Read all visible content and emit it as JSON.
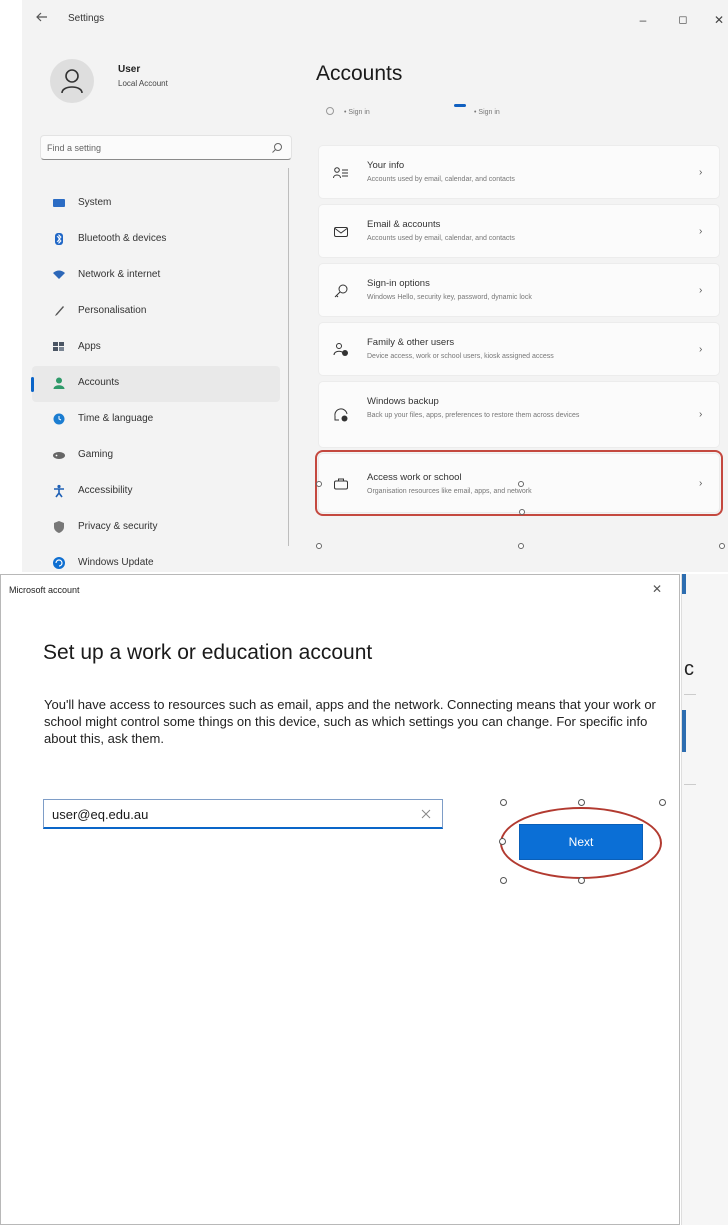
{
  "settings": {
    "app_title": "Settings",
    "back_icon": "back-arrow-icon",
    "window_controls": {
      "minimize": "–",
      "maximize": "◻",
      "close": "✕"
    },
    "profile": {
      "name": "User",
      "account_type": "Local Account"
    },
    "search": {
      "placeholder": "Find a setting"
    },
    "nav": [
      {
        "label": "System",
        "icon": "monitor-icon",
        "color": "#2b6cc4"
      },
      {
        "label": "Bluetooth & devices",
        "icon": "bluetooth-icon",
        "color": "#1f66c6"
      },
      {
        "label": "Network & internet",
        "icon": "wifi-icon",
        "color": "#2c67b8"
      },
      {
        "label": "Personalisation",
        "icon": "brush-icon",
        "color": "#555555"
      },
      {
        "label": "Apps",
        "icon": "apps-icon",
        "color": "#4a5563"
      },
      {
        "label": "Accounts",
        "icon": "accounts-icon",
        "color": "#2f9a6a",
        "active": true
      },
      {
        "label": "Time & language",
        "icon": "globe-clock-icon",
        "color": "#1b7dd1"
      },
      {
        "label": "Gaming",
        "icon": "gamepad-icon",
        "color": "#666666"
      },
      {
        "label": "Accessibility",
        "icon": "accessibility-icon",
        "color": "#1d5fb5"
      },
      {
        "label": "Privacy & security",
        "icon": "shield-icon",
        "color": "#666666"
      },
      {
        "label": "Windows Update",
        "icon": "update-icon",
        "color": "#0f6fd1"
      }
    ],
    "page_title": "Accounts",
    "signin_strip": {
      "left": "• Sign in",
      "right": "• Sign in"
    },
    "cards": [
      {
        "title": "Your info",
        "desc": "Accounts used by email, calendar, and contacts",
        "icon": "person-info-icon"
      },
      {
        "title": "Email & accounts",
        "desc": "Accounts used by email, calendar, and contacts",
        "icon": "mail-icon"
      },
      {
        "title": "Sign-in options",
        "desc": "Windows Hello, security key, password, dynamic lock",
        "icon": "key-icon"
      },
      {
        "title": "Family & other users",
        "desc": "Device access, work or school users, kiosk assigned access",
        "icon": "family-icon"
      },
      {
        "title": "Windows backup",
        "desc": "Back up your files, apps, preferences to restore them across devices",
        "icon": "backup-icon"
      },
      {
        "title": "Access work or school",
        "desc": "Organisation resources like email, apps, and network",
        "icon": "briefcase-icon",
        "highlighted": true
      }
    ]
  },
  "dialog": {
    "title": "Microsoft account",
    "close": "✕",
    "heading": "Set up a work or education account",
    "body": "You'll have access to resources such as email, apps and the network. Connecting means that your work or school might control some things on this device, such as which settings you can change. For specific info about this, ask them.",
    "email_value": "user@eq.edu.au",
    "next_label": "Next"
  },
  "colors": {
    "accent": "#0b6fd6",
    "annotation_red": "#c4483f"
  }
}
